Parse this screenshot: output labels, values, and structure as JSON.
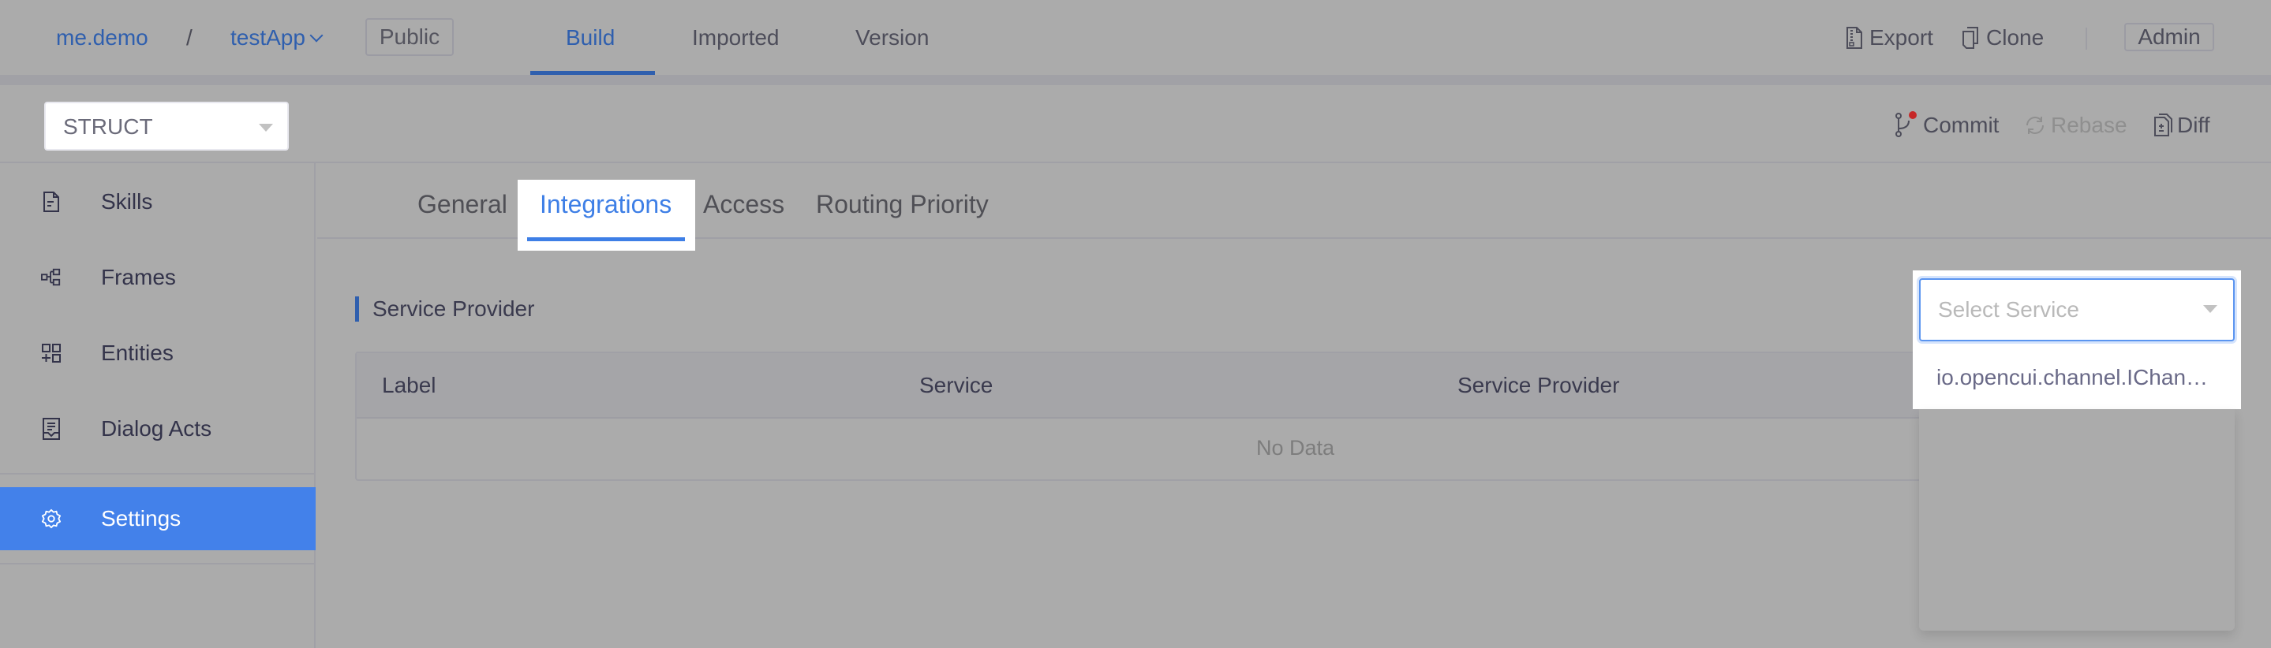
{
  "header": {
    "breadcrumb": {
      "org": "me.demo",
      "separator": "/",
      "app": "testApp"
    },
    "visibility_badge": "Public",
    "nav_tabs": [
      {
        "label": "Build",
        "active": true
      },
      {
        "label": "Imported",
        "active": false
      },
      {
        "label": "Version",
        "active": false
      }
    ],
    "actions": {
      "export": "Export",
      "clone": "Clone"
    },
    "role_badge": "Admin"
  },
  "toolbar": {
    "type_select": {
      "value": "STRUCT"
    },
    "commit": "Commit",
    "commit_has_changes": true,
    "rebase": "Rebase",
    "rebase_disabled": true,
    "diff": "Diff"
  },
  "sidebar": {
    "items": [
      {
        "label": "Skills",
        "icon": "document-icon",
        "active": false
      },
      {
        "label": "Frames",
        "icon": "tree-structure-icon",
        "active": false
      },
      {
        "label": "Entities",
        "icon": "blocks-add-icon",
        "active": false
      },
      {
        "label": "Dialog Acts",
        "icon": "inbox-document-icon",
        "active": false
      },
      {
        "label": "Settings",
        "icon": "gear-icon",
        "active": true
      }
    ]
  },
  "main": {
    "tabs": [
      {
        "label": "General",
        "active": false
      },
      {
        "label": "Integrations",
        "active": true
      },
      {
        "label": "Access",
        "active": false
      },
      {
        "label": "Routing Priority",
        "active": false
      }
    ],
    "section_title": "Service Provider",
    "table": {
      "columns": [
        "Label",
        "Service",
        "Service Provider"
      ],
      "rows": [],
      "empty_text": "No Data"
    },
    "service_select": {
      "placeholder": "Select Service",
      "options": [
        "io.opencui.channel.IChan…"
      ]
    }
  },
  "colors": {
    "accent": "#3e7fe6",
    "sidebar_active": "#4381ea",
    "link": "#2f5fae",
    "commit_dot": "#c62828"
  }
}
